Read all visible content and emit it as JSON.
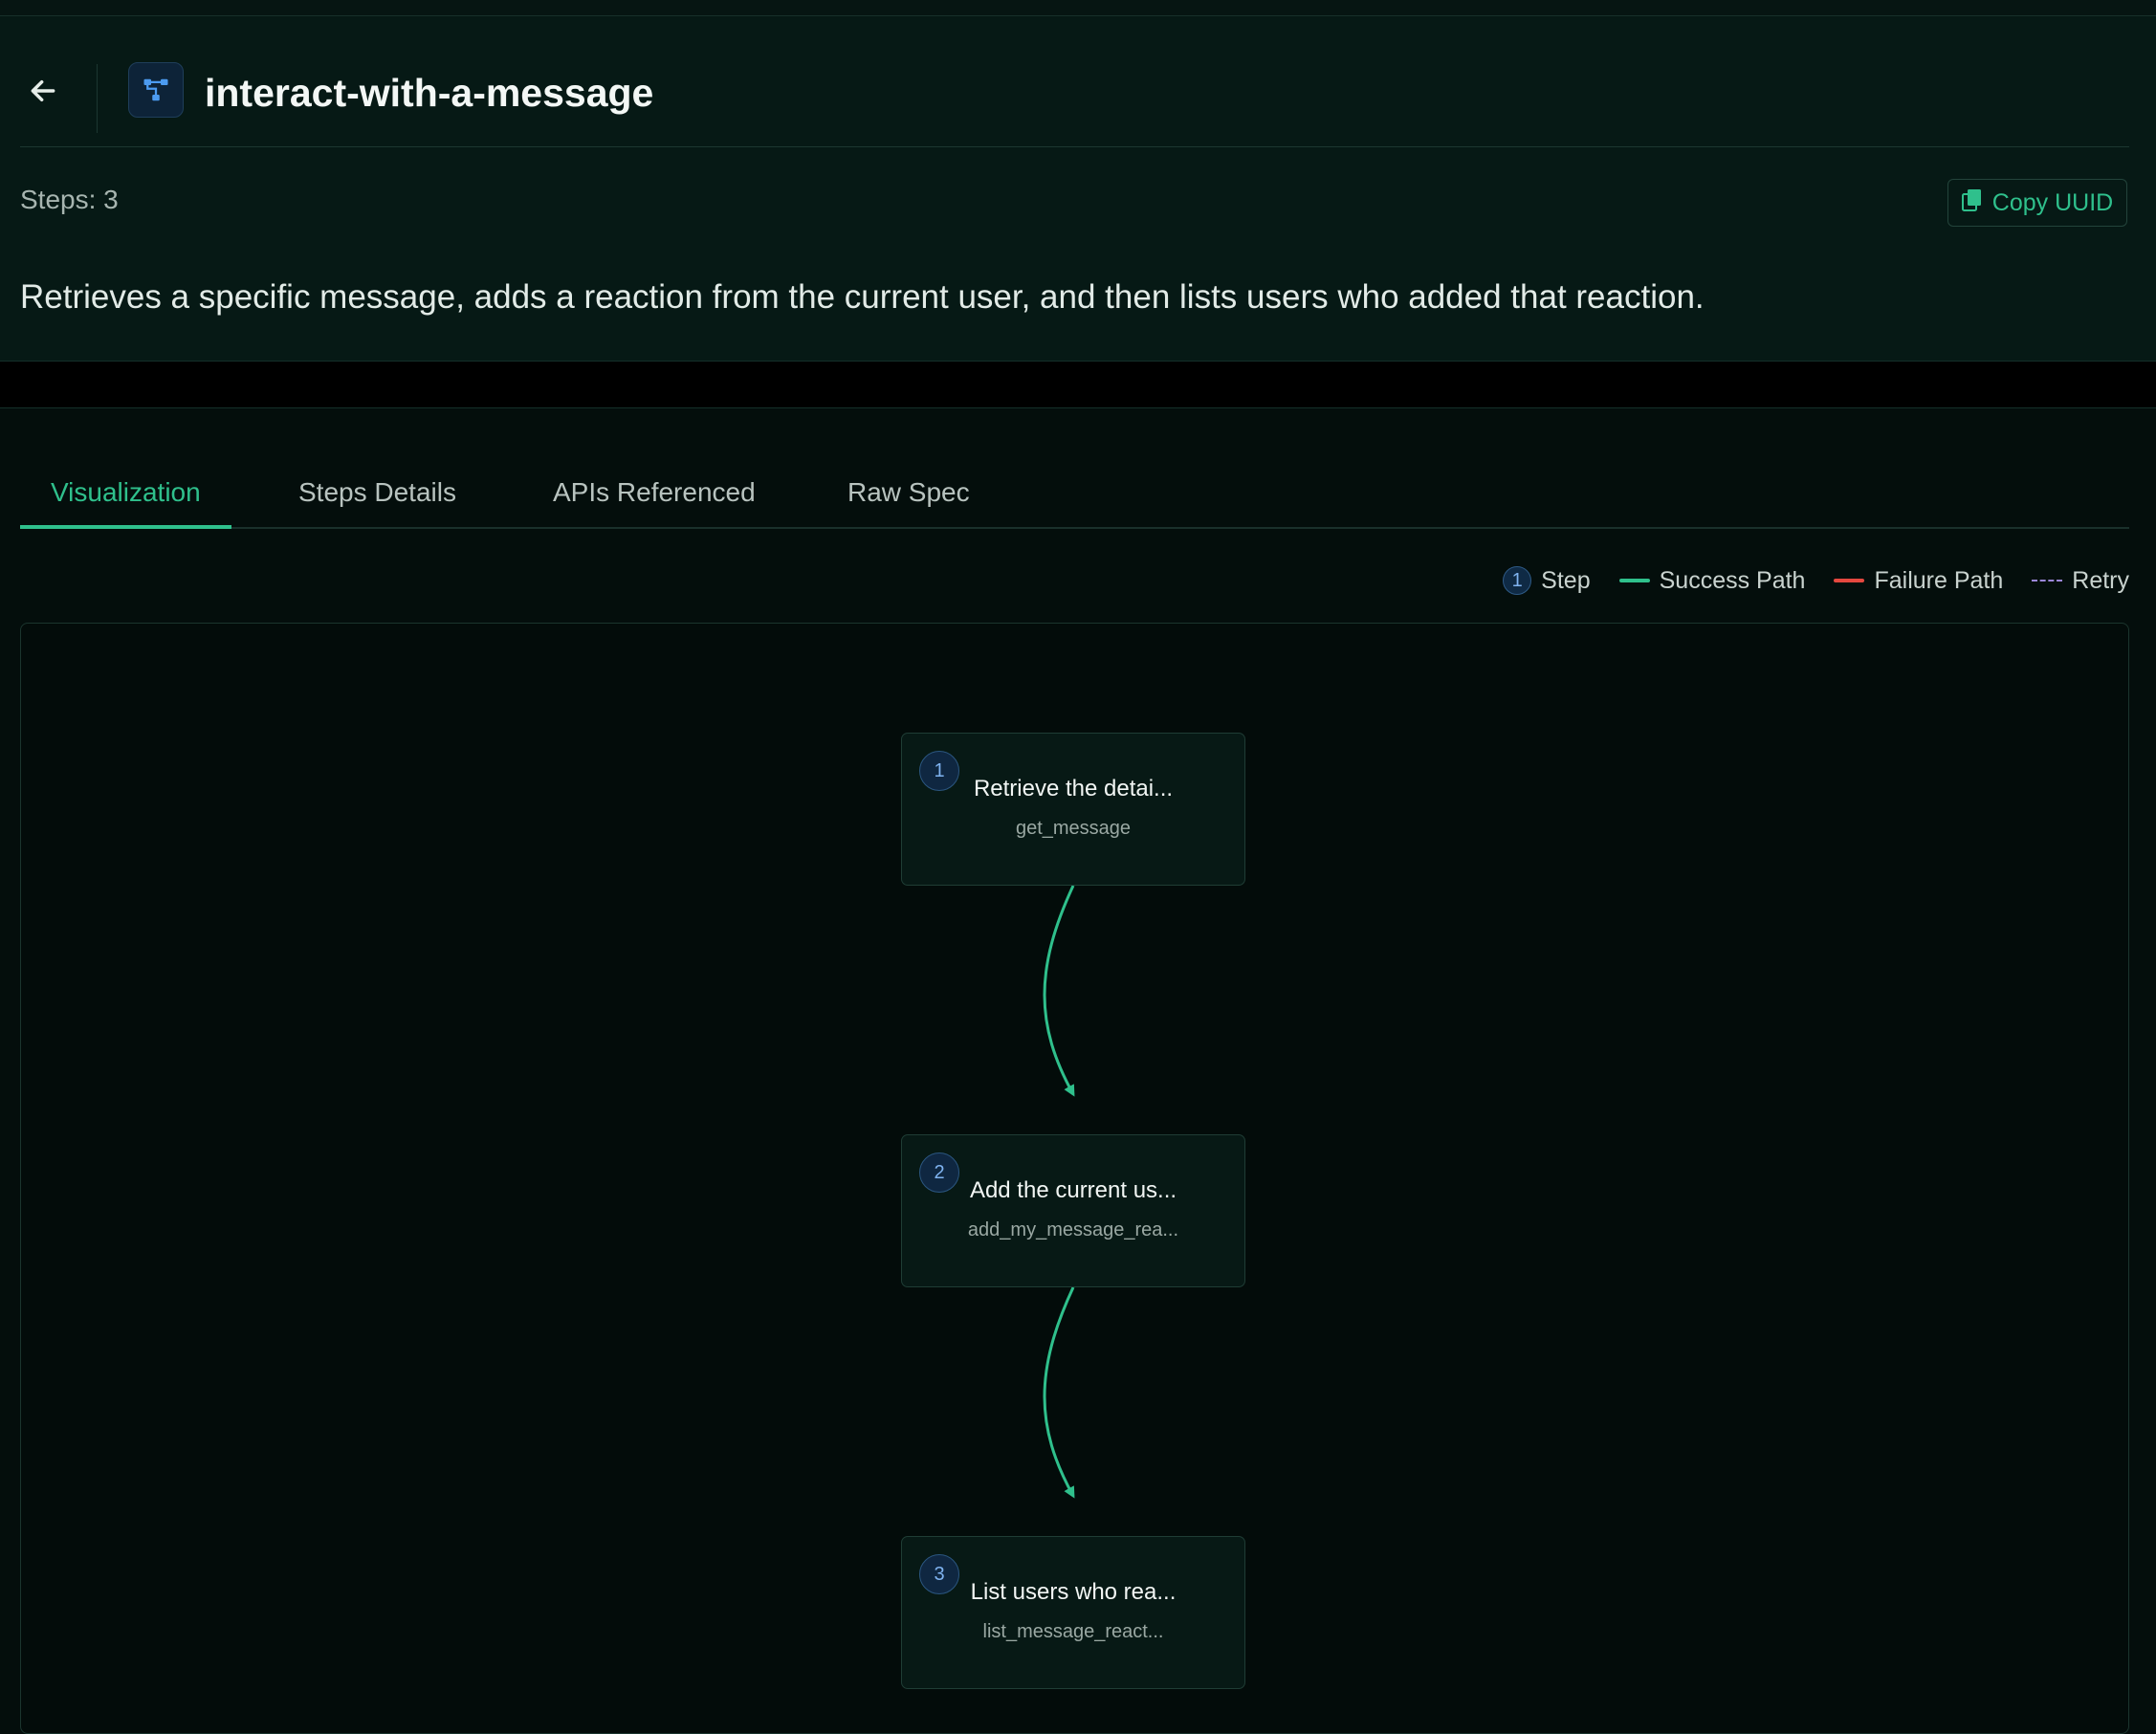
{
  "header": {
    "title": "interact-with-a-message",
    "steps_label": "Steps: 3",
    "copy_uuid_label": "Copy UUID",
    "description": "Retrieves a specific message, adds a reaction from the current user, and then lists users who added that reaction."
  },
  "tabs": [
    {
      "label": "Visualization",
      "active": true
    },
    {
      "label": "Steps Details",
      "active": false
    },
    {
      "label": "APIs Referenced",
      "active": false
    },
    {
      "label": "Raw Spec",
      "active": false
    }
  ],
  "legend": {
    "step_number": "1",
    "step_label": "Step",
    "success_label": "Success Path",
    "failure_label": "Failure Path",
    "retry_label": "Retry",
    "colors": {
      "success": "#2fc08c",
      "failure": "#e5483f",
      "retry": "#9b87d9"
    }
  },
  "flow": {
    "nodes": [
      {
        "number": "1",
        "title": "Retrieve the detai...",
        "operation": "get_message"
      },
      {
        "number": "2",
        "title": "Add the current us...",
        "operation": "add_my_message_rea..."
      },
      {
        "number": "3",
        "title": "List users who rea...",
        "operation": "list_message_react..."
      }
    ],
    "edges": [
      {
        "from": "1",
        "to": "2",
        "type": "success"
      },
      {
        "from": "2",
        "to": "3",
        "type": "success"
      }
    ]
  },
  "icons": {
    "back": "arrow-left-icon",
    "workflow": "workflow-icon",
    "copy": "clipboard-icon"
  }
}
